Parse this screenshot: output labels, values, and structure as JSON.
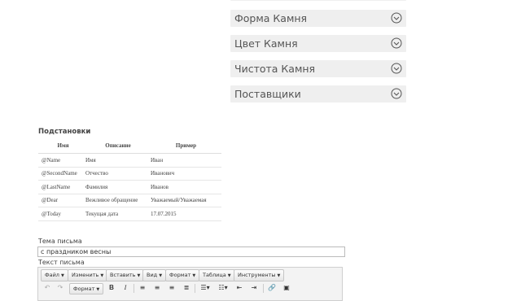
{
  "accordions": [
    {
      "label": "Форма Камня"
    },
    {
      "label": "Цвет Камня"
    },
    {
      "label": "Чистота Камня"
    },
    {
      "label": "Поставщики"
    }
  ],
  "substitutions": {
    "title": "Подстановки",
    "headers": [
      "Имя",
      "Описание",
      "Пример"
    ],
    "rows": [
      [
        "@Name",
        "Имя",
        "Иван"
      ],
      [
        "@SecondName",
        "Отчество",
        "Иванович"
      ],
      [
        "@LastName",
        "Фамилия",
        "Иванов"
      ],
      [
        "@Dear",
        "Вежливое обращение",
        "Уважаемый/Уважаемая"
      ],
      [
        "@Today",
        "Текущая дата",
        "17.07.2015"
      ]
    ]
  },
  "subject": {
    "label": "Тема письма",
    "value": "с праздником весны"
  },
  "body": {
    "label": "Текст письма"
  },
  "editor": {
    "menus": [
      "Файл",
      "Изменить",
      "Вставить",
      "Вид",
      "Формат",
      "Таблица",
      "Инструменты"
    ],
    "format_label": "Формат",
    "icons": [
      "undo-icon",
      "redo-icon",
      "bold-icon",
      "italic-icon",
      "align-left-icon",
      "align-center-icon",
      "align-right-icon",
      "align-justify-icon",
      "bullet-list-icon",
      "numbered-list-icon",
      "outdent-icon",
      "indent-icon",
      "link-icon",
      "image-icon"
    ]
  }
}
